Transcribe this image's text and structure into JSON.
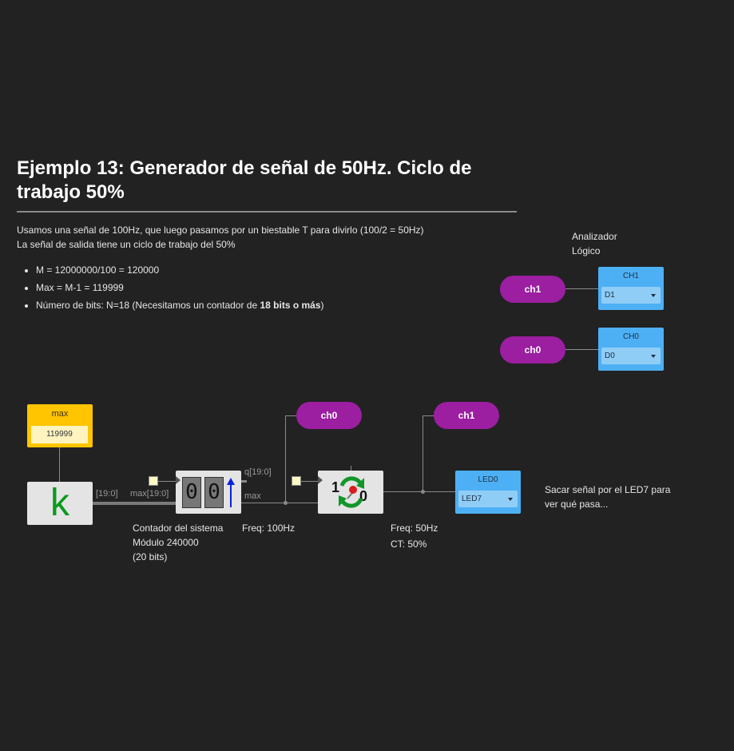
{
  "heading": {
    "title": "Ejemplo 13: Generador de señal de 50Hz. Ciclo de trabajo 50%"
  },
  "intro": {
    "line1": "Usamos una señal de 100Hz, que luego pasamos por un biestable T para divirlo (100/2 = 50Hz)",
    "line2": "La señal de salida tiene un ciclo de trabajo del 50%"
  },
  "bullets": {
    "b1": "M = 12000000/100 = 120000",
    "b2": "Max = M-1 = 119999",
    "b3_prefix": "Número de bits: N=18 (Necesitamos un contador de ",
    "b3_bold": "18 bits o más",
    "b3_suffix": ")"
  },
  "analyzer": {
    "label_line1": "Analizador",
    "label_line2": "Lógico",
    "ch1_label": "ch1",
    "ch1_caption": "CH1",
    "ch1_value": "D1",
    "ch0_label": "ch0",
    "ch0_caption": "CH0",
    "ch0_value": "D0"
  },
  "circuit": {
    "max_caption": "max",
    "max_value": "119999",
    "clock_glyph": "k",
    "bus_label": "[19:0]",
    "max_bus_label": "max[19:0]",
    "q_label": "q[19:0]",
    "max_out_label": "max",
    "counter_digits": [
      "0",
      "0"
    ],
    "tff_one": "1",
    "tff_zero": "0",
    "ch0_tag": "ch0",
    "ch1_tag": "ch1",
    "led_caption": "LED0",
    "led_value": "LED7"
  },
  "notes": {
    "counter_line1": "Contador del sistema",
    "counter_line2": "Módulo 240000",
    "counter_line3": "(20 bits)",
    "freq100": "Freq: 100Hz",
    "freq50": "Freq: 50Hz",
    "ct": "CT: 50%",
    "led_note_line1": "Sacar señal por el LED7 para",
    "led_note_line2": "ver qué pasa..."
  },
  "colors": {
    "background": "#222222",
    "pill": "#9c1ea1",
    "blue_block": "#4db0f5",
    "yellow_block": "#ffc500",
    "clock_green": "#0a9a1e"
  }
}
